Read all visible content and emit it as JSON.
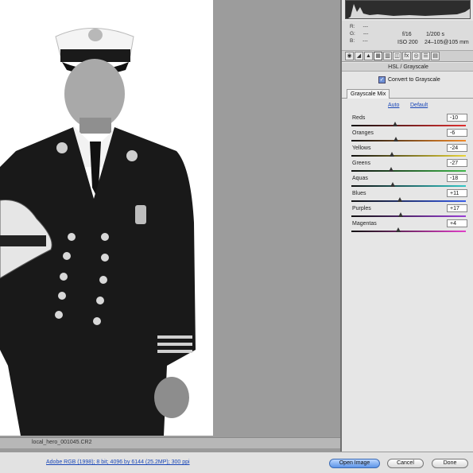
{
  "canvas": {
    "filename": "local_hero_001045.CR2"
  },
  "readout": {
    "r_label": "R:",
    "g_label": "G:",
    "b_label": "B:",
    "rgb_value": "---",
    "aperture": "f/16",
    "shutter": "1/200 s",
    "iso": "ISO 200",
    "lens": "24–105@105 mm"
  },
  "panel": {
    "section_title": "HSL / Grayscale",
    "convert_label": "Convert to Grayscale",
    "convert_checked": true,
    "subtab": "Grayscale Mix",
    "auto": "Auto",
    "default": "Default"
  },
  "sliders": [
    {
      "name": "Reds",
      "value": -10,
      "display": "-10",
      "gradient": [
        "#111111",
        "#e03030"
      ]
    },
    {
      "name": "Oranges",
      "value": -6,
      "display": "-6",
      "gradient": [
        "#111111",
        "#f08a2a"
      ]
    },
    {
      "name": "Yellows",
      "value": -24,
      "display": "-24",
      "gradient": [
        "#111111",
        "#e8d43a"
      ]
    },
    {
      "name": "Greens",
      "value": -27,
      "display": "-27",
      "gradient": [
        "#111111",
        "#3fb84a"
      ]
    },
    {
      "name": "Aquas",
      "value": -18,
      "display": "-18",
      "gradient": [
        "#111111",
        "#34c6c6"
      ]
    },
    {
      "name": "Blues",
      "value": 11,
      "display": "+11",
      "gradient": [
        "#111111",
        "#3a5ee8"
      ]
    },
    {
      "name": "Purples",
      "value": 17,
      "display": "+17",
      "gradient": [
        "#111111",
        "#9a3fd6"
      ]
    },
    {
      "name": "Magentas",
      "value": 4,
      "display": "+4",
      "gradient": [
        "#111111",
        "#e03fc8"
      ]
    }
  ],
  "slider_range": [
    -200,
    300
  ],
  "bottom": {
    "info": "Adobe RGB (1998); 8 bit; 4096 by 6144 (25.2MP); 300 ppi",
    "open_image": "Open Image",
    "cancel": "Cancel",
    "done": "Done"
  },
  "colors": {
    "accent": "#5c94e8",
    "link": "#1a47b8"
  }
}
